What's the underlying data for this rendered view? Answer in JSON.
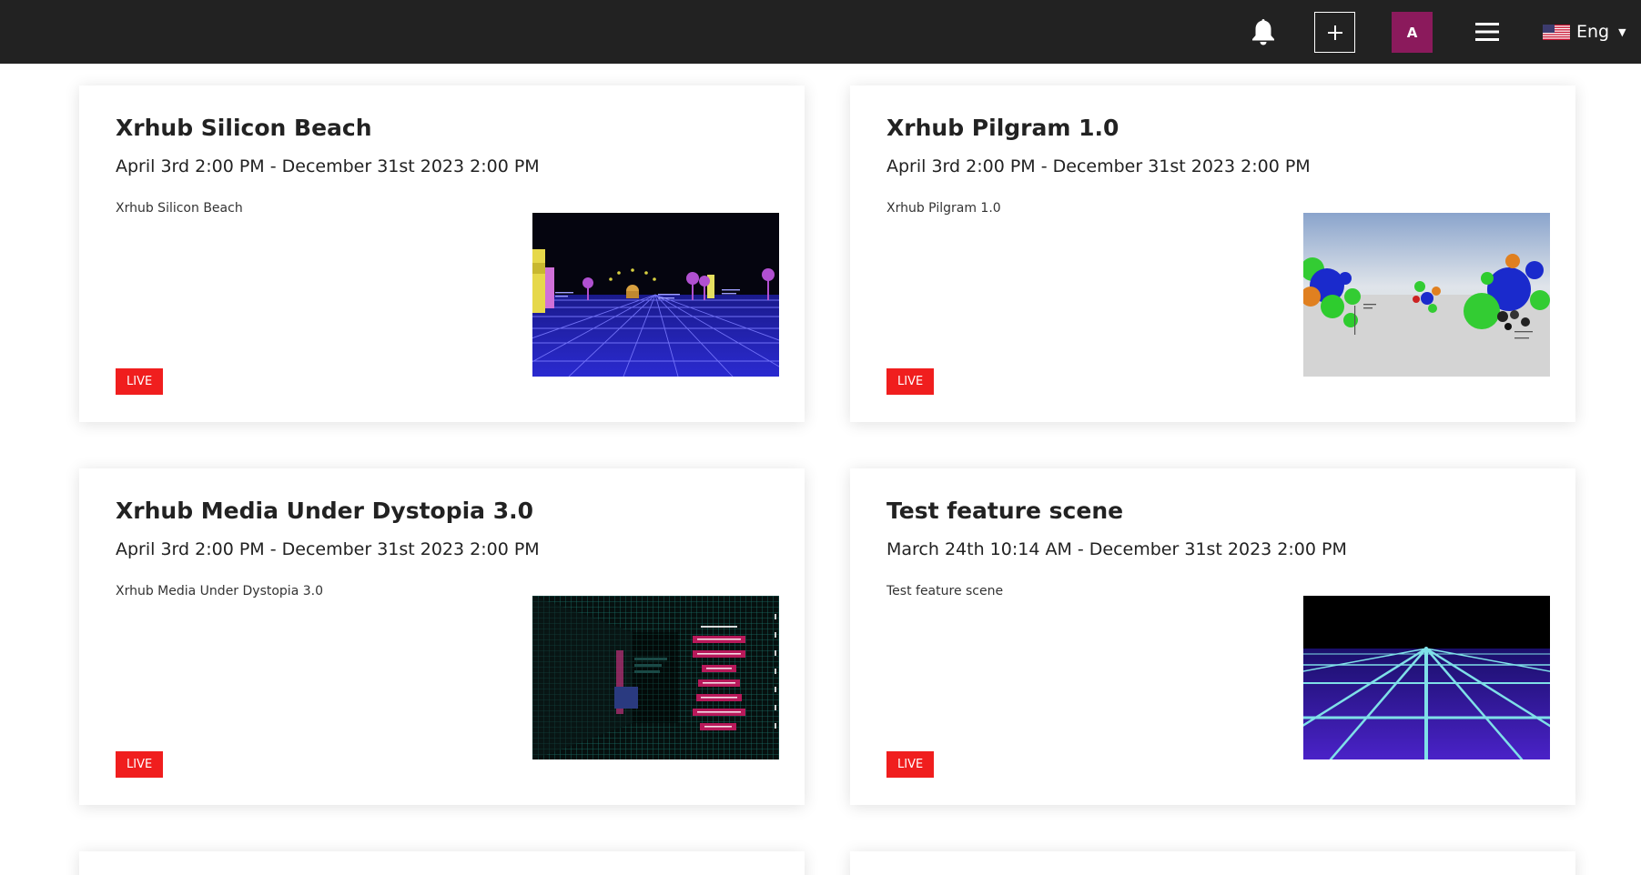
{
  "header": {
    "avatar_initial": "A",
    "language": "Eng",
    "brand_color": "#8b1a5c"
  },
  "events": [
    {
      "title": "Xrhub Silicon Beach",
      "date": "April 3rd 2:00 PM - December 31st 2023 2:00 PM",
      "description": "Xrhub Silicon Beach",
      "status": "LIVE"
    },
    {
      "title": "Xrhub Pilgram 1.0",
      "date": "April 3rd 2:00 PM - December 31st 2023 2:00 PM",
      "description": "Xrhub Pilgram 1.0",
      "status": "LIVE"
    },
    {
      "title": "Xrhub Media Under Dystopia 3.0",
      "date": "April 3rd 2:00 PM - December 31st 2023 2:00 PM",
      "description": "Xrhub Media Under Dystopia 3.0",
      "status": "LIVE"
    },
    {
      "title": "Test feature scene",
      "date": "March 24th 10:14 AM - December 31st 2023 2:00 PM",
      "description": "Test feature scene",
      "status": "LIVE"
    }
  ],
  "colors": {
    "live_badge": "#f01e1e",
    "topbar": "#222222"
  },
  "icons": {
    "notifications": "bell-icon",
    "create": "plus-icon",
    "menu": "hamburger-menu-icon",
    "language_flag": "us-flag-icon",
    "language_dropdown": "caret-down-icon"
  }
}
